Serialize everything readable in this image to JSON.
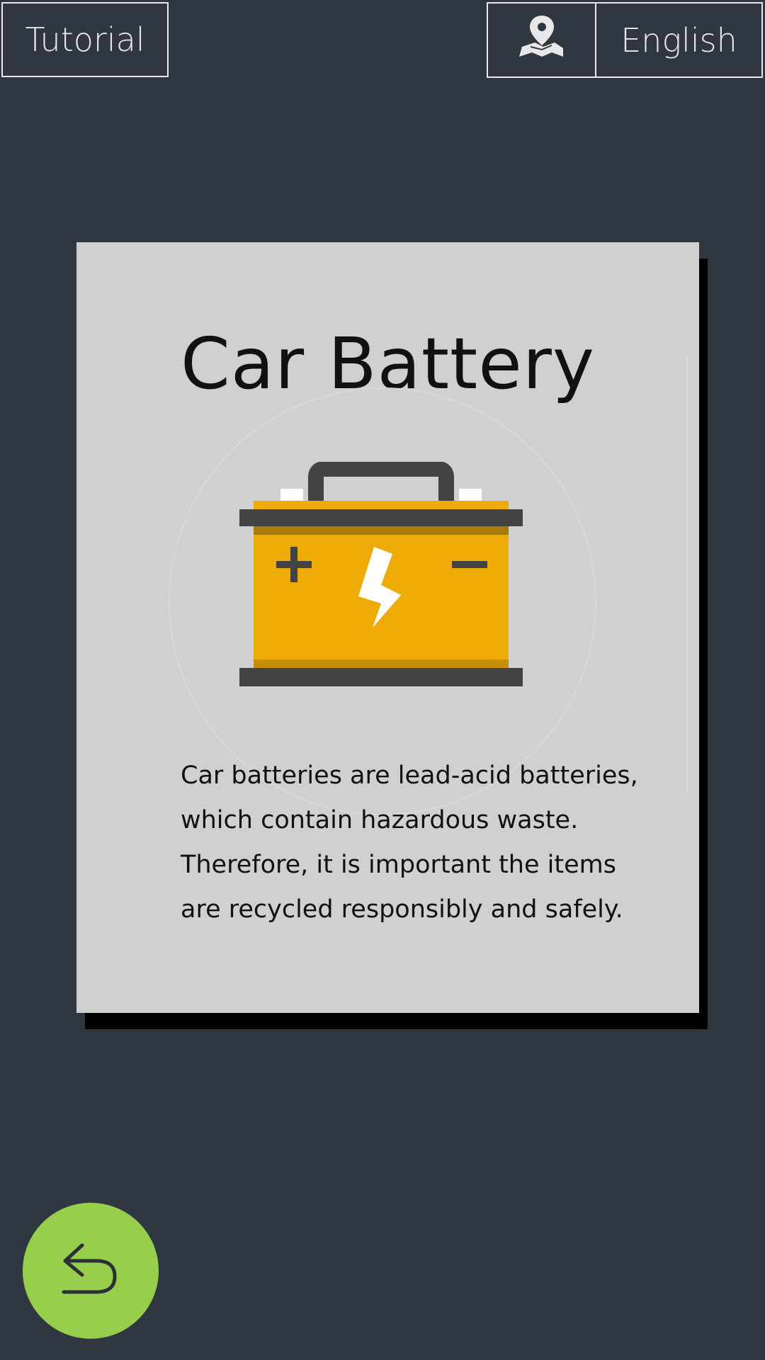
{
  "header": {
    "tutorial_label": "Tutorial",
    "map_icon": "map-pin-icon",
    "language_label": "English"
  },
  "card": {
    "title": "Car Battery",
    "image_icon": "car-battery-icon",
    "description": "Car batteries are lead-acid batteries, which contain hazardous waste. Therefore, it is important the items are recycled responsibly and safely."
  },
  "footer": {
    "back_icon": "back-arrow-icon"
  },
  "colors": {
    "background": "#313741",
    "card": "#d0d0d0",
    "accent_green": "#97cf4d",
    "battery_body": "#eeaa05",
    "battery_dark": "#434343"
  }
}
